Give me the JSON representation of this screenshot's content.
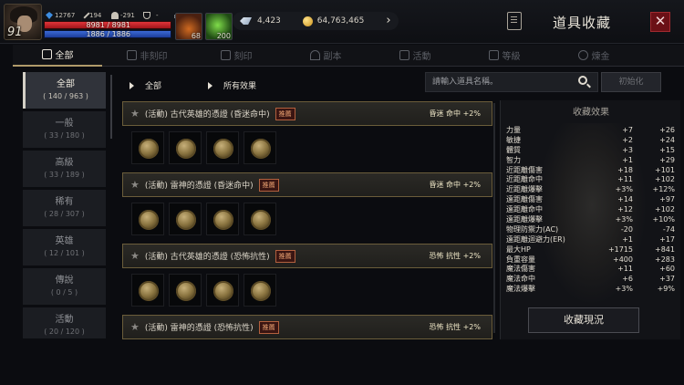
{
  "player": {
    "level": "91",
    "gem_count": "12767",
    "attack": "194",
    "defense": "-291",
    "trophy": "-",
    "hp_text": "8981 / 8981",
    "hp_fraction": 1.0,
    "mp_text": "1886 / 1886",
    "mp_fraction": 1.0
  },
  "buffs": [
    {
      "name": "potion",
      "count": "68"
    },
    {
      "name": "leaf",
      "count": "200"
    }
  ],
  "currency": {
    "diamonds": "4,423",
    "gold": "64,763,465"
  },
  "header": {
    "title": "道具收藏",
    "close": "✕"
  },
  "tabs": [
    {
      "label": "全部",
      "active": true
    },
    {
      "label": "非刻印",
      "active": false
    },
    {
      "label": "刻印",
      "active": false
    },
    {
      "label": "副本",
      "active": false
    },
    {
      "label": "活動",
      "active": false
    },
    {
      "label": "等級",
      "active": false
    },
    {
      "label": "煉金",
      "active": false
    }
  ],
  "sidebar": [
    {
      "label": "全部",
      "count": "( 140 / 963 )",
      "active": true
    },
    {
      "label": "一般",
      "count": "( 33 / 180 )",
      "active": false
    },
    {
      "label": "高級",
      "count": "( 33 / 189 )",
      "active": false
    },
    {
      "label": "稀有",
      "count": "( 28 / 307 )",
      "active": false
    },
    {
      "label": "英雄",
      "count": "( 12 / 101 )",
      "active": false
    },
    {
      "label": "傳說",
      "count": "( 0 / 5 )",
      "active": false
    },
    {
      "label": "活動",
      "count": "( 20 / 120 )",
      "active": false
    }
  ],
  "filters": {
    "category": "全部",
    "effect": "所有效果"
  },
  "search": {
    "placeholder": "請輸入道具名稱。",
    "reset": "初始化"
  },
  "entries": [
    {
      "title": "(活動) 古代英雄的憑證 (昏迷命中)",
      "tag": "推薦",
      "effect": "昏迷 命中 +2%"
    },
    {
      "title": "(活動) 雷神的憑證 (昏迷命中)",
      "tag": "推薦",
      "effect": "昏迷 命中 +2%"
    },
    {
      "title": "(活動) 古代英雄的憑證 (恐怖抗性)",
      "tag": "推薦",
      "effect": "恐怖 抗性 +2%"
    },
    {
      "title": "(活動) 雷神的憑證 (恐怖抗性)",
      "tag": "推薦",
      "effect": "恐怖 抗性 +2%"
    }
  ],
  "panel": {
    "title": "收藏效果",
    "button": "收藏現況",
    "rows": [
      {
        "name": "力量",
        "a": "+7",
        "b": "+26"
      },
      {
        "name": "敏捷",
        "a": "+2",
        "b": "+24"
      },
      {
        "name": "體質",
        "a": "+3",
        "b": "+15"
      },
      {
        "name": "智力",
        "a": "+1",
        "b": "+29"
      },
      {
        "name": "近距離傷害",
        "a": "+18",
        "b": "+101"
      },
      {
        "name": "近距離命中",
        "a": "+11",
        "b": "+102"
      },
      {
        "name": "近距離爆擊",
        "a": "+3%",
        "b": "+12%"
      },
      {
        "name": "遠距離傷害",
        "a": "+14",
        "b": "+97"
      },
      {
        "name": "遠距離命中",
        "a": "+12",
        "b": "+102"
      },
      {
        "name": "遠距離爆擊",
        "a": "+3%",
        "b": "+10%"
      },
      {
        "name": "物理防禦力(AC)",
        "a": "-20",
        "b": "-74"
      },
      {
        "name": "遠距離迴避力(ER)",
        "a": "+1",
        "b": "+17"
      },
      {
        "name": "最大HP",
        "a": "+1715",
        "b": "+841"
      },
      {
        "name": "負重容量",
        "a": "+400",
        "b": "+283"
      },
      {
        "name": "魔法傷害",
        "a": "+11",
        "b": "+60"
      },
      {
        "name": "魔法命中",
        "a": "+6",
        "b": "+37"
      },
      {
        "name": "魔法爆擊",
        "a": "+3%",
        "b": "+9%"
      }
    ]
  }
}
